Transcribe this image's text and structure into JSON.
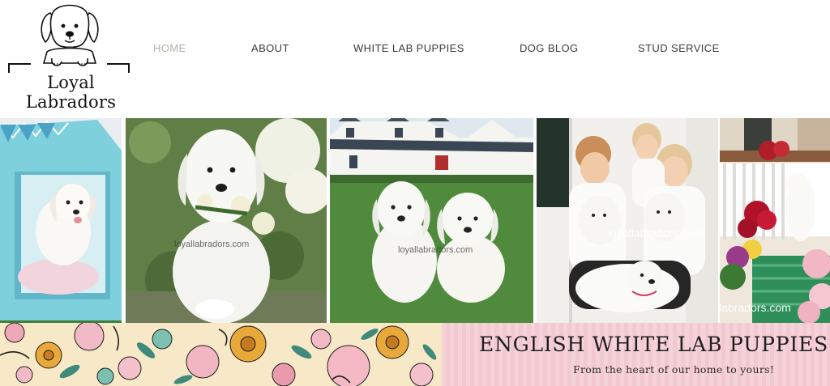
{
  "logo": {
    "text": "Loyal Labradors",
    "icon": "labrador-puppy-icon"
  },
  "nav": {
    "items": [
      {
        "label": "HOME",
        "active": true
      },
      {
        "label": "ABOUT",
        "active": false
      },
      {
        "label": "WHITE LAB PUPPIES",
        "active": false
      },
      {
        "label": "DOG BLOG",
        "active": false
      },
      {
        "label": "STUD SERVICE",
        "active": false
      }
    ]
  },
  "photos": {
    "watermarks": [
      "loyallabradors.com",
      "loyallabradors.com",
      "loyallabradors.com",
      "llabradors.com"
    ]
  },
  "banner": {
    "title": "ENGLISH WHITE LAB PUPPIES",
    "subtitle": "From the heart of our home to yours!"
  },
  "colors": {
    "nav_text": "#3b3b3b",
    "nav_active": "#b7b1a4",
    "banner_pink": "#f6d3d9",
    "floral_cream": "#f7e8c8"
  }
}
